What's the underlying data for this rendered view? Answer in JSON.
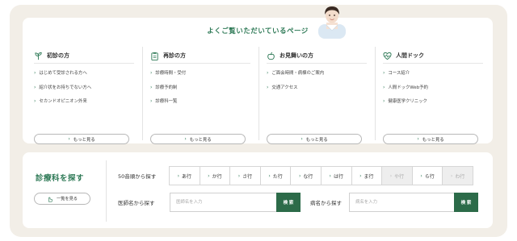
{
  "faq": {
    "title": "よくご覧いただいているページ",
    "columns": [
      {
        "title": "初診の方",
        "icon": "sprout-icon",
        "links": [
          "はじめて受診される方へ",
          "紹介状をお持ちでない方へ",
          "セカンドオピニオン外来"
        ],
        "more": "もっと見る"
      },
      {
        "title": "再診の方",
        "icon": "clipboard-icon",
        "links": [
          "診療時間・受付",
          "診療予約制",
          "診療科一覧"
        ],
        "more": "もっと見る"
      },
      {
        "title": "お見舞いの方",
        "icon": "apple-icon",
        "links": [
          "ご面会時間・病棟のご案内",
          "交通アクセス"
        ],
        "more": "もっと見る"
      },
      {
        "title": "人間ドック",
        "icon": "heart-pulse-icon",
        "links": [
          "コース紹介",
          "人間ドックWeb予約",
          "健康医学クリニック"
        ],
        "more": "もっと見る"
      }
    ]
  },
  "search": {
    "title": "診療科を探す",
    "list_button": "一覧を見る",
    "kana_label": "50音順から探す",
    "kana": [
      {
        "label": "あ行",
        "enabled": true
      },
      {
        "label": "か行",
        "enabled": true
      },
      {
        "label": "さ行",
        "enabled": true
      },
      {
        "label": "た行",
        "enabled": true
      },
      {
        "label": "な行",
        "enabled": true
      },
      {
        "label": "は行",
        "enabled": true
      },
      {
        "label": "ま行",
        "enabled": true
      },
      {
        "label": "や行",
        "enabled": false
      },
      {
        "label": "ら行",
        "enabled": true
      },
      {
        "label": "わ行",
        "enabled": false
      }
    ],
    "doctor_label": "医師名から探す",
    "doctor_placeholder": "医師名を入力",
    "doctor_button": "検 索",
    "illness_label": "病名から探す",
    "illness_placeholder": "病名を入力",
    "illness_button": "検 索"
  },
  "colors": {
    "accent": "#2f7a57",
    "button": "#2c6b49",
    "background": "#f2eee7"
  }
}
